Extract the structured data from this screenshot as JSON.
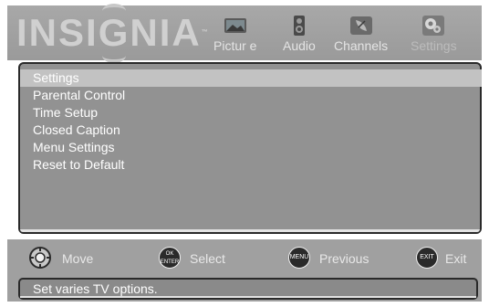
{
  "header": {
    "brand": "INSIGNIA",
    "brand_mark": "™",
    "tabs": [
      {
        "label": "Pictur e",
        "icon": "picture-icon"
      },
      {
        "label": "Audio",
        "icon": "speaker-icon"
      },
      {
        "label": "Channels",
        "icon": "satellite-dish-icon"
      },
      {
        "label": "Settings",
        "icon": "gear-icon",
        "active": true
      }
    ]
  },
  "menu": {
    "items": [
      {
        "label": "Settings",
        "selected": true
      },
      {
        "label": "Parental Control"
      },
      {
        "label": "Time Setup"
      },
      {
        "label": "Closed Caption"
      },
      {
        "label": "Menu Settings"
      },
      {
        "label": "Reset to Default"
      }
    ]
  },
  "footer": {
    "controls": [
      {
        "button": "",
        "label": "Move",
        "icon": "dpad-icon"
      },
      {
        "button": "OK ENTER",
        "label": "Select",
        "icon": "ok-enter-button-icon"
      },
      {
        "button": "MENU",
        "label": "Previous",
        "icon": "menu-button-icon"
      },
      {
        "button": "EXIT",
        "label": "Exit",
        "icon": "exit-button-icon"
      }
    ],
    "status": "Set varies TV options."
  },
  "colors": {
    "header_bg": "#a0a0a0",
    "panel_bg": "#929292",
    "selected_bg": "#c2c2c2",
    "text": "#ffffff"
  }
}
